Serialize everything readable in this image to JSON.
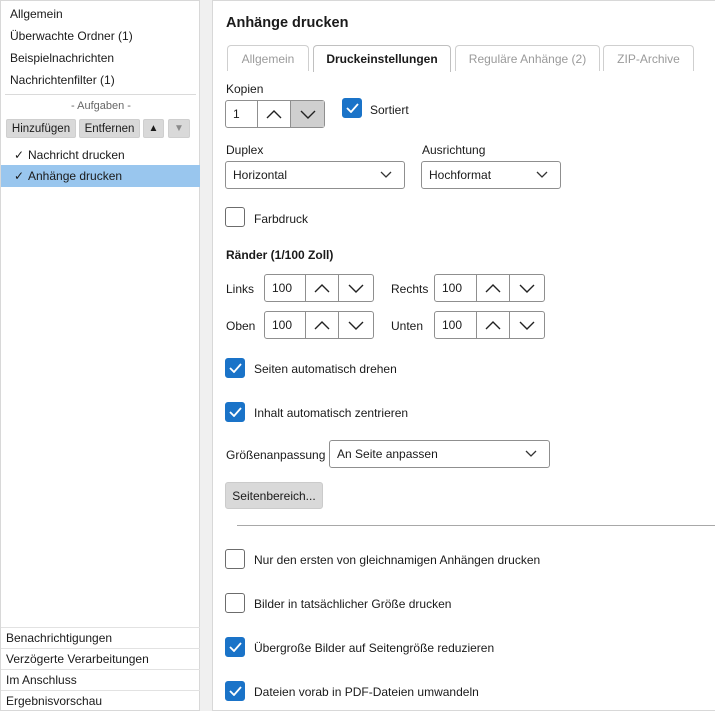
{
  "sidebar": {
    "nav": [
      "Allgemein",
      "Überwachte Ordner (1)",
      "Beispielnachrichten",
      "Nachrichtenfilter (1)"
    ],
    "tasks_header": "- Aufgaben -",
    "buttons": {
      "add": "Hinzufügen",
      "remove": "Entfernen",
      "up": "▲",
      "down": "▼"
    },
    "tasks": [
      {
        "check": "✓",
        "label": "Nachricht drucken",
        "selected": false
      },
      {
        "check": "✓",
        "label": "Anhänge drucken",
        "selected": true
      }
    ],
    "bottom": [
      "Benachrichtigungen",
      "Verzögerte Verarbeitungen",
      "Im Anschluss",
      "Ergebnisvorschau"
    ]
  },
  "main": {
    "title": "Anhänge drucken",
    "tabs": [
      "Allgemein",
      "Druckeinstellungen",
      "Reguläre Anhänge (2)",
      "ZIP-Archive"
    ],
    "active_tab": "Druckeinstellungen",
    "copies": {
      "label": "Kopien",
      "value": "1",
      "sorted_label": "Sortiert",
      "sorted": true
    },
    "duplex": {
      "label": "Duplex",
      "value": "Horizontal"
    },
    "orientation": {
      "label": "Ausrichtung",
      "value": "Hochformat"
    },
    "color": {
      "label": "Farbdruck",
      "checked": false
    },
    "margins": {
      "title": "Ränder (1/100 Zoll)",
      "left": {
        "label": "Links",
        "value": "100"
      },
      "right": {
        "label": "Rechts",
        "value": "100"
      },
      "top": {
        "label": "Oben",
        "value": "100"
      },
      "bottom": {
        "label": "Unten",
        "value": "100"
      }
    },
    "auto_rotate": {
      "label": "Seiten automatisch drehen",
      "checked": true
    },
    "auto_center": {
      "label": "Inhalt automatisch zentrieren",
      "checked": true
    },
    "fit": {
      "label": "Größenanpassung",
      "value": "An Seite anpassen"
    },
    "page_range_button": "Seitenbereich...",
    "options": [
      {
        "label": "Nur den ersten von gleichnamigen Anhängen drucken",
        "checked": false
      },
      {
        "label": "Bilder in tatsächlicher Größe drucken",
        "checked": false
      },
      {
        "label": "Übergroße Bilder auf Seitengröße reduzieren",
        "checked": true
      },
      {
        "label": "Dateien vorab in PDF-Dateien umwandeln",
        "checked": true
      }
    ]
  },
  "colors": {
    "accent": "#1a73c8",
    "selection": "#99c6ee"
  }
}
